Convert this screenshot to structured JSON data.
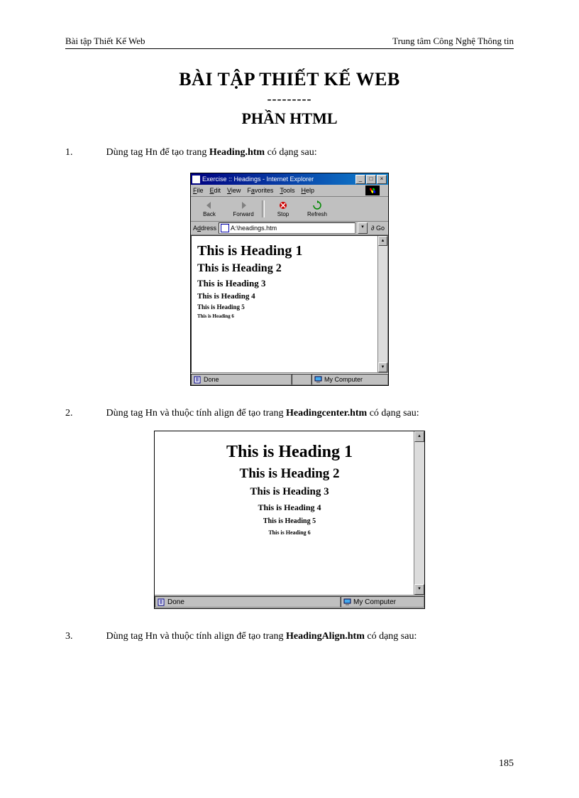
{
  "header": {
    "left": "Bài tập Thiết Kế Web",
    "right": "Trung tâm Công Nghệ Thông tin"
  },
  "titles": {
    "main": "BÀI TẬP THIẾT KẾ WEB",
    "separator": "---------",
    "sub": "PHẦN  HTML"
  },
  "exercises": [
    {
      "num": "1.",
      "text_prefix": "Dùng tag Hn để tạo trang ",
      "bold": "Heading.htm",
      "text_suffix": " có dạng sau:"
    },
    {
      "num": "2.",
      "text_prefix": "Dùng tag Hn và thuộc tính align để tạo trang ",
      "bold": "Headingcenter.htm",
      "text_suffix": " có dạng sau:"
    },
    {
      "num": "3.",
      "text_prefix": "Dùng tag Hn và thuộc tính align để tạo trang ",
      "bold": "HeadingAlign.htm",
      "text_suffix": " có dạng sau:"
    }
  ],
  "ie_window": {
    "title": "Exercise :: Headings - Internet Explorer",
    "menu": {
      "file": "File",
      "edit": "Edit",
      "view": "View",
      "favorites": "Favorites",
      "tools": "Tools",
      "help": "Help"
    },
    "toolbar": {
      "back": "Back",
      "forward": "Forward",
      "stop": "Stop",
      "refresh": "Refresh"
    },
    "address_label": "Address",
    "address_value": "A:\\headings.htm",
    "go_label": "Go",
    "headings": {
      "h1": "This is Heading 1",
      "h2": "This is Heading 2",
      "h3": "This is Heading 3",
      "h4": "This is Heading 4",
      "h5": "This is Heading 5",
      "h6": "This is Heading 6"
    },
    "status_done": "Done",
    "status_zone": "My Computer"
  },
  "snippet": {
    "headings": {
      "h1": "This is Heading 1",
      "h2": "This is Heading 2",
      "h3": "This is Heading 3",
      "h4": "This is Heading 4",
      "h5": "This is Heading 5",
      "h6": "This is Heading 6"
    },
    "status_done": "Done",
    "status_zone": "My Computer"
  },
  "page_number": "185"
}
